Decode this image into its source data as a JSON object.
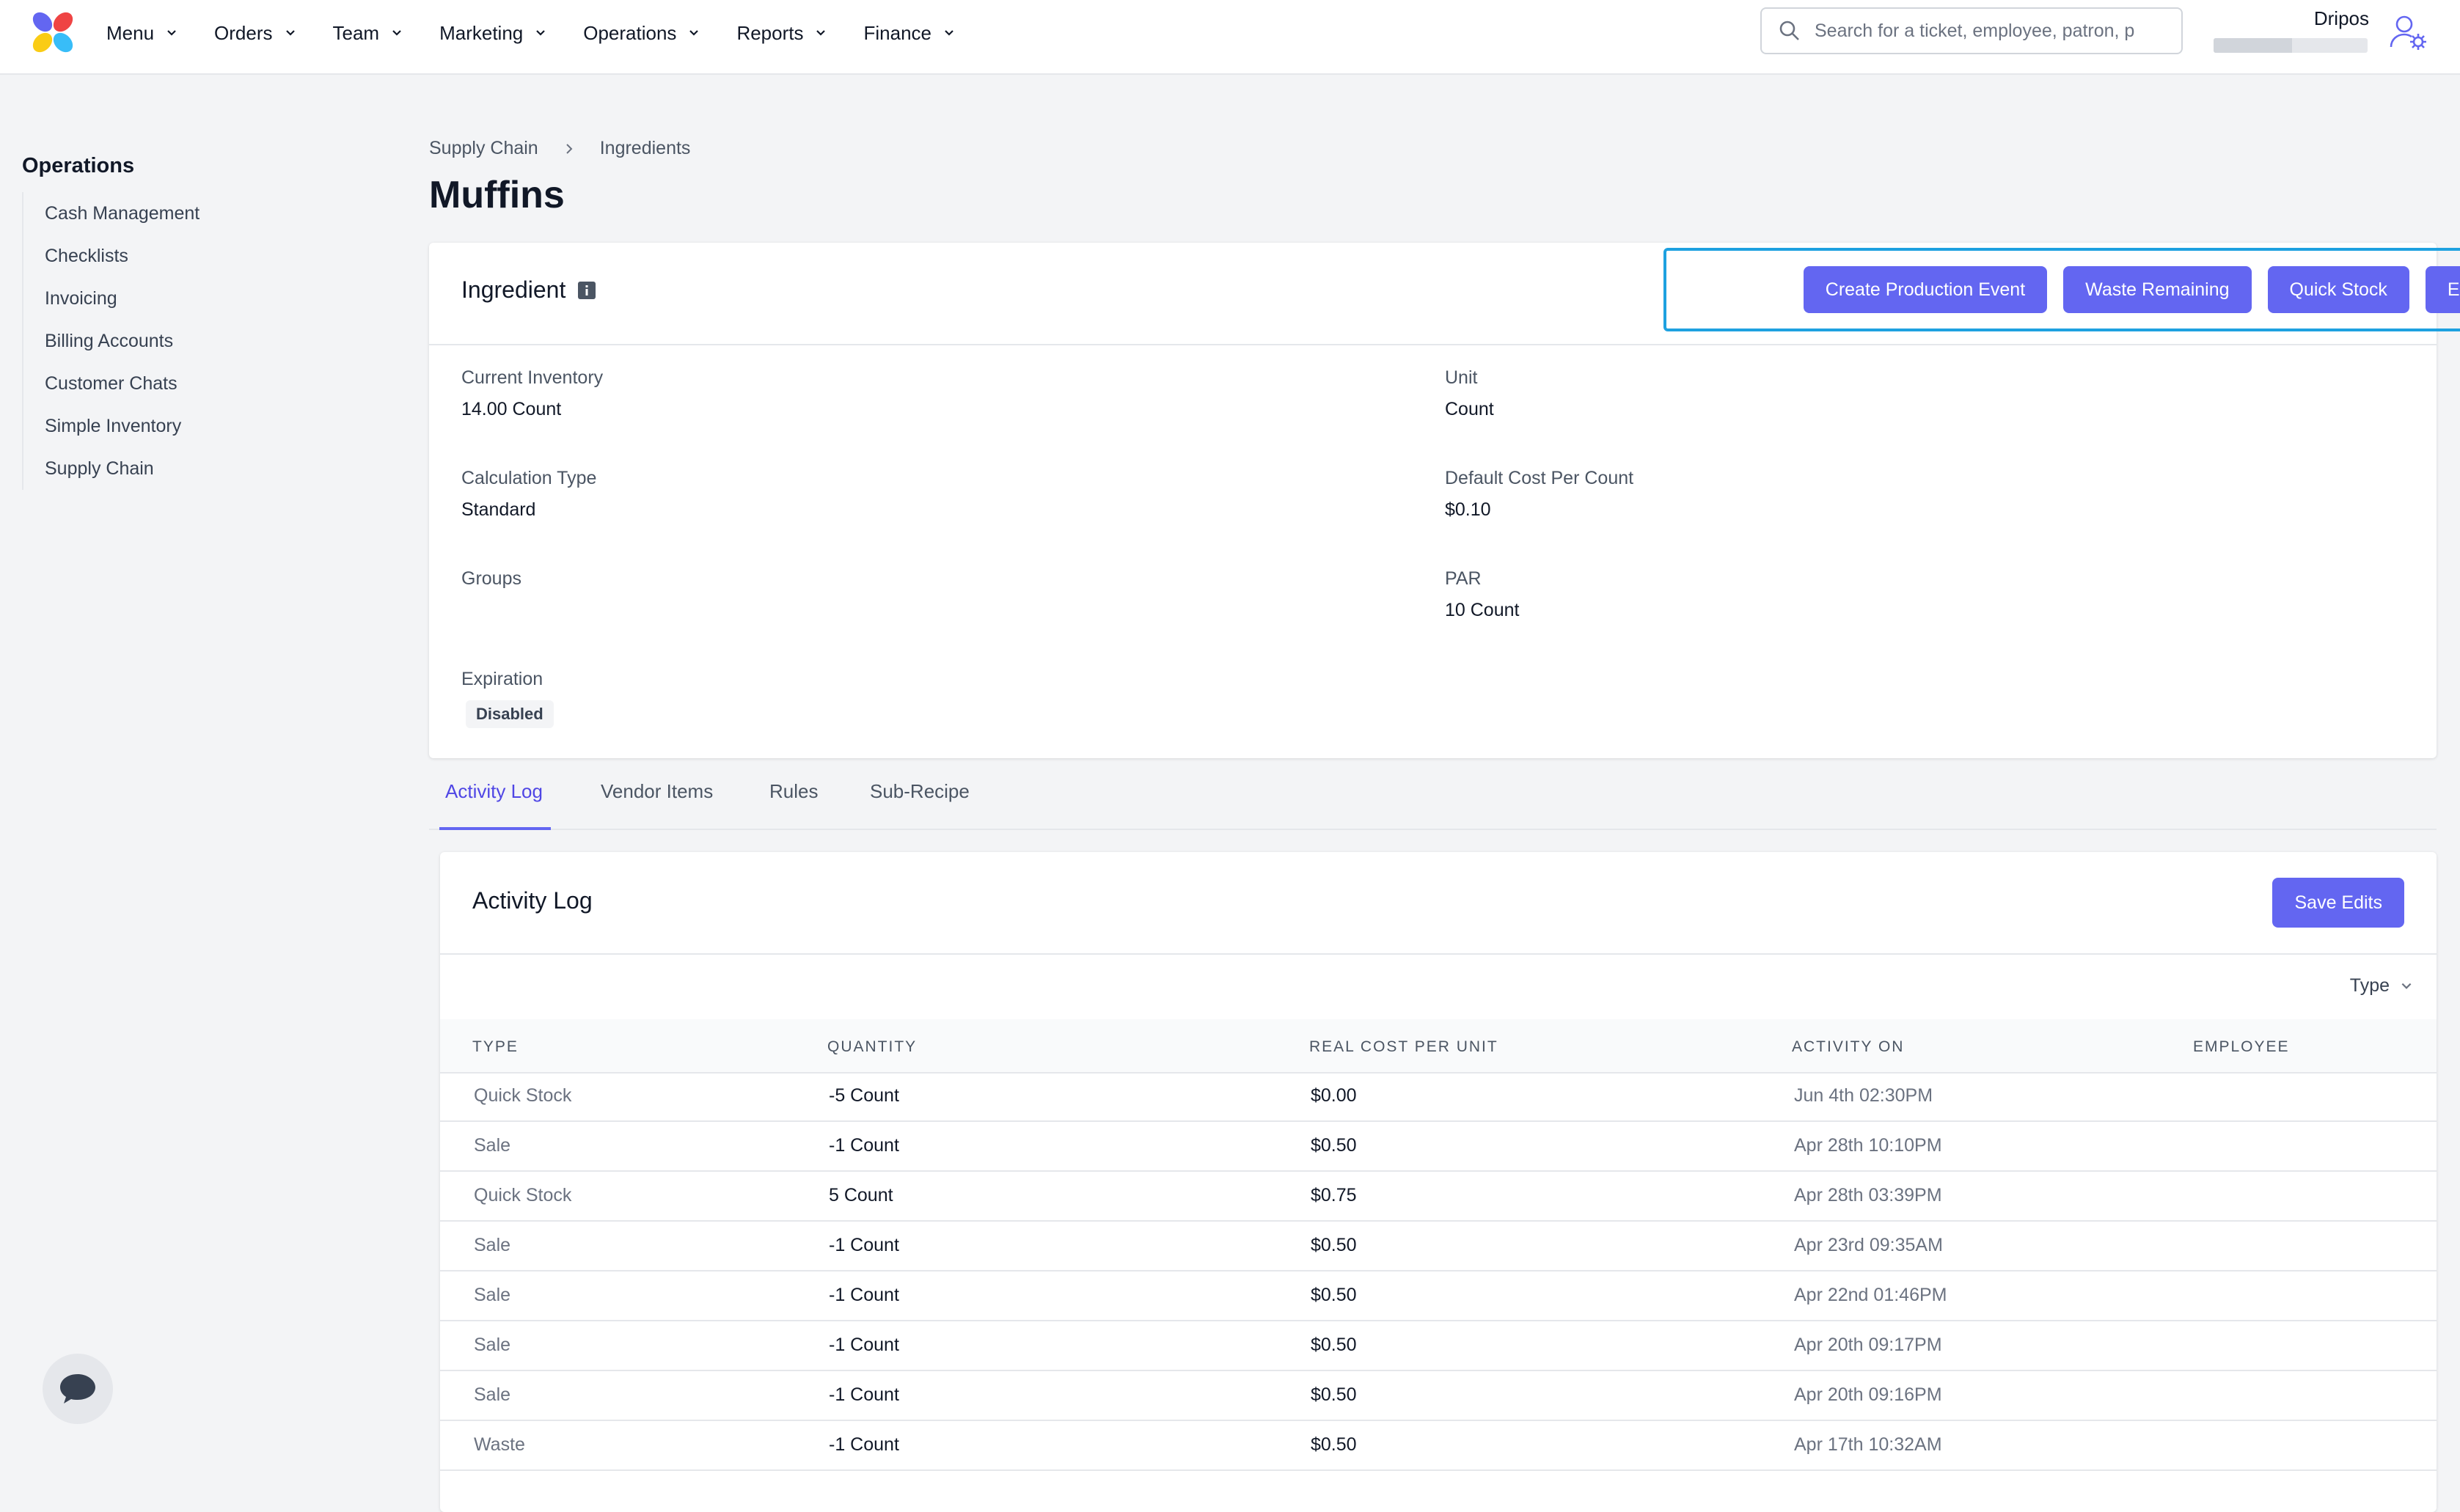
{
  "nav": {
    "items": [
      {
        "label": "Menu"
      },
      {
        "label": "Orders"
      },
      {
        "label": "Team"
      },
      {
        "label": "Marketing"
      },
      {
        "label": "Operations"
      },
      {
        "label": "Reports"
      },
      {
        "label": "Finance"
      }
    ],
    "search_placeholder": "Search for a ticket, employee, patron, p",
    "account_name": "Dripos",
    "account_progress": 0.51
  },
  "sidebar": {
    "title": "Operations",
    "items": [
      {
        "label": "Cash Management"
      },
      {
        "label": "Checklists"
      },
      {
        "label": "Invoicing"
      },
      {
        "label": "Billing Accounts"
      },
      {
        "label": "Customer Chats"
      },
      {
        "label": "Simple Inventory"
      },
      {
        "label": "Supply Chain"
      }
    ]
  },
  "breadcrumb": {
    "parent": "Supply Chain",
    "current": "Ingredients"
  },
  "page": {
    "title": "Muffins"
  },
  "ingredient_card": {
    "title": "Ingredient",
    "buttons": {
      "create_production": "Create Production Event",
      "waste_remaining": "Waste Remaining",
      "quick_stock": "Quick Stock",
      "edit": "Edit"
    },
    "fields": {
      "current_inventory_label": "Current Inventory",
      "current_inventory_value": "14.00 Count",
      "unit_label": "Unit",
      "unit_value": "Count",
      "calc_type_label": "Calculation Type",
      "calc_type_value": "Standard",
      "default_cost_label": "Default Cost Per Count",
      "default_cost_value": "$0.10",
      "groups_label": "Groups",
      "par_label": "PAR",
      "par_value": "10 Count",
      "expiration_label": "Expiration",
      "expiration_value": "Disabled"
    }
  },
  "tabs": [
    {
      "label": "Activity Log",
      "active": true
    },
    {
      "label": "Vendor Items"
    },
    {
      "label": "Rules"
    },
    {
      "label": "Sub-Recipe"
    }
  ],
  "activity_log": {
    "title": "Activity Log",
    "save_label": "Save Edits",
    "filter_label": "Type",
    "columns": [
      "TYPE",
      "QUANTITY",
      "REAL COST PER UNIT",
      "ACTIVITY ON",
      "EMPLOYEE"
    ],
    "rows": [
      {
        "type": "Quick Stock",
        "quantity": "-5 Count",
        "cost": "$0.00",
        "activity_on": "Jun 4th 02:30PM",
        "employee": ""
      },
      {
        "type": "Sale",
        "quantity": "-1 Count",
        "cost": "$0.50",
        "activity_on": "Apr 28th 10:10PM",
        "employee": ""
      },
      {
        "type": "Quick Stock",
        "quantity": "5 Count",
        "cost": "$0.75",
        "activity_on": "Apr 28th 03:39PM",
        "employee": ""
      },
      {
        "type": "Sale",
        "quantity": "-1 Count",
        "cost": "$0.50",
        "activity_on": "Apr 23rd 09:35AM",
        "employee": ""
      },
      {
        "type": "Sale",
        "quantity": "-1 Count",
        "cost": "$0.50",
        "activity_on": "Apr 22nd 01:46PM",
        "employee": ""
      },
      {
        "type": "Sale",
        "quantity": "-1 Count",
        "cost": "$0.50",
        "activity_on": "Apr 20th 09:17PM",
        "employee": ""
      },
      {
        "type": "Sale",
        "quantity": "-1 Count",
        "cost": "$0.50",
        "activity_on": "Apr 20th 09:16PM",
        "employee": ""
      },
      {
        "type": "Waste",
        "quantity": "-1 Count",
        "cost": "$0.50",
        "activity_on": "Apr 17th 10:32AM",
        "employee": ""
      }
    ]
  },
  "icons": {
    "logo": "dripos-logo",
    "search": "search-icon",
    "user_settings": "user-gear-icon",
    "chat": "chat-icon",
    "info": "info-icon"
  },
  "colors": {
    "accent": "#6366f1",
    "highlight_border": "#1ea1e0",
    "background": "#f3f4f6"
  }
}
